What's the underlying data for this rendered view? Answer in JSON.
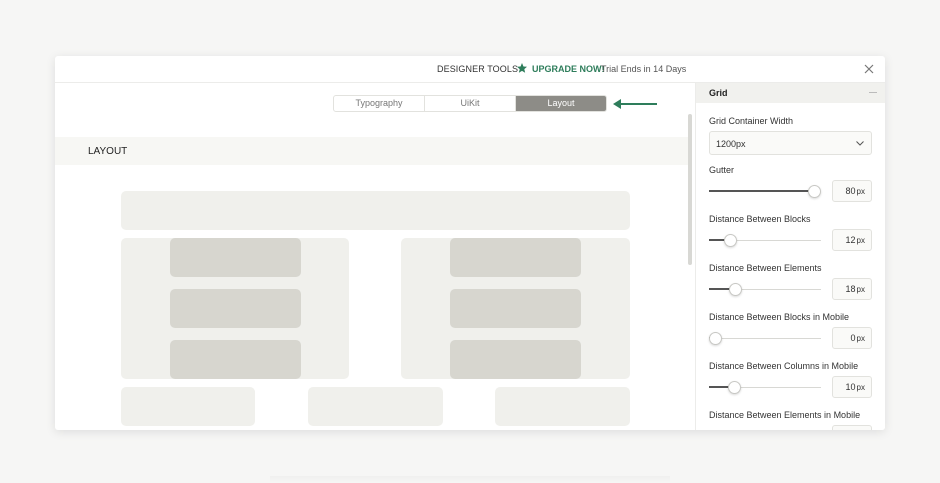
{
  "topbar": {
    "tools_label": "DESIGNER TOOLS",
    "upgrade_label": "UPGRADE NOW!",
    "trial_text": "Trial Ends in 14 Days",
    "accent_color": "#2e7d5b"
  },
  "tabs": [
    {
      "label": "Typography",
      "active": false
    },
    {
      "label": "UiKit",
      "active": false
    },
    {
      "label": "Layout",
      "active": true
    }
  ],
  "section": {
    "title": "LAYOUT"
  },
  "panel": {
    "title": "Grid",
    "container_width": {
      "label": "Grid Container Width",
      "value": "1200px"
    },
    "controls": [
      {
        "label": "Gutter",
        "value": "80",
        "unit": "px",
        "level": 1.0
      },
      {
        "label": "Distance Between Blocks",
        "value": "12",
        "unit": "px",
        "level": 0.15
      },
      {
        "label": "Distance Between Elements",
        "value": "18",
        "unit": "px",
        "level": 0.2
      },
      {
        "label": "Distance Between Blocks in Mobile",
        "value": "0",
        "unit": "px",
        "level": 0.0
      },
      {
        "label": "Distance Between Columns in Mobile",
        "value": "10",
        "unit": "px",
        "level": 0.19
      },
      {
        "label": "Distance Between Elements in Mobile"
      }
    ]
  },
  "icons": {
    "star": "star-icon",
    "close": "close-icon",
    "arrow": "arrow-left-icon",
    "chevron": "chevron-down-icon"
  }
}
